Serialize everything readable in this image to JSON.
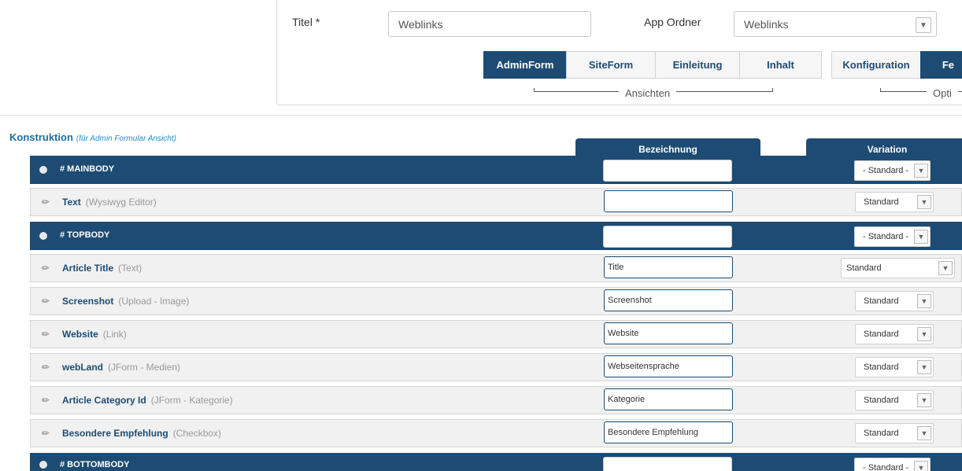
{
  "header": {
    "title_label": "Titel",
    "required_mark": "*",
    "title_value": "Weblinks",
    "app_folder_label": "App Ordner",
    "app_folder_value": "Weblinks"
  },
  "view_tabs": [
    {
      "label": "AdminForm",
      "active": true
    },
    {
      "label": "SiteForm",
      "active": false
    },
    {
      "label": "Einleitung",
      "active": false
    },
    {
      "label": "Inhalt",
      "active": false
    },
    {
      "label": "Konfiguration",
      "active": false
    },
    {
      "label": "Fe",
      "active": true
    }
  ],
  "groups": {
    "views_label": "Ansichten",
    "options_label": "Opti"
  },
  "construction": {
    "title": "Konstruktion",
    "subtitle": "(für Admin Formular Ansicht)",
    "col_bezeichnung": "Bezeichnung",
    "col_variation": "Variation"
  },
  "rows": [
    {
      "kind": "group",
      "title": "# MAINBODY",
      "bez": "",
      "variation": "- Standard -"
    },
    {
      "kind": "field",
      "name": "Text",
      "type": "(Wysiwyg Editor)",
      "bez": "",
      "variation": "Standard"
    },
    {
      "kind": "group",
      "title": "# TOPBODY",
      "bez": "",
      "variation": "- Standard -"
    },
    {
      "kind": "field",
      "name": "Article Title",
      "type": "(Text)",
      "bez": "Title",
      "variation": "Standard"
    },
    {
      "kind": "field",
      "name": "Screenshot",
      "type": "(Upload - Image)",
      "bez": "Screenshot",
      "variation": "Standard"
    },
    {
      "kind": "field",
      "name": "Website",
      "type": "(Link)",
      "bez": "Website",
      "variation": "Standard"
    },
    {
      "kind": "field",
      "name": "webLand",
      "type": "(JForm - Medien)",
      "bez": "Webseitensprache",
      "variation": "Standard"
    },
    {
      "kind": "field",
      "name": "Article Category Id",
      "type": "(JForm - Kategorie)",
      "bez": "Kategorie",
      "variation": "Standard"
    },
    {
      "kind": "field",
      "name": "Besondere Empfehlung",
      "type": "(Checkbox)",
      "bez": "Besondere Empfehlung",
      "variation": "Standard"
    },
    {
      "kind": "group",
      "title": "# BOTTOMBODY",
      "bez": "",
      "variation": "- Standard -"
    }
  ],
  "icons": {
    "bullet": "bullet-icon",
    "pencil": "pencil-icon",
    "chevron": "chevron-down-icon"
  },
  "colors": {
    "accent": "#1d4b73",
    "link": "#1d6fa3"
  }
}
